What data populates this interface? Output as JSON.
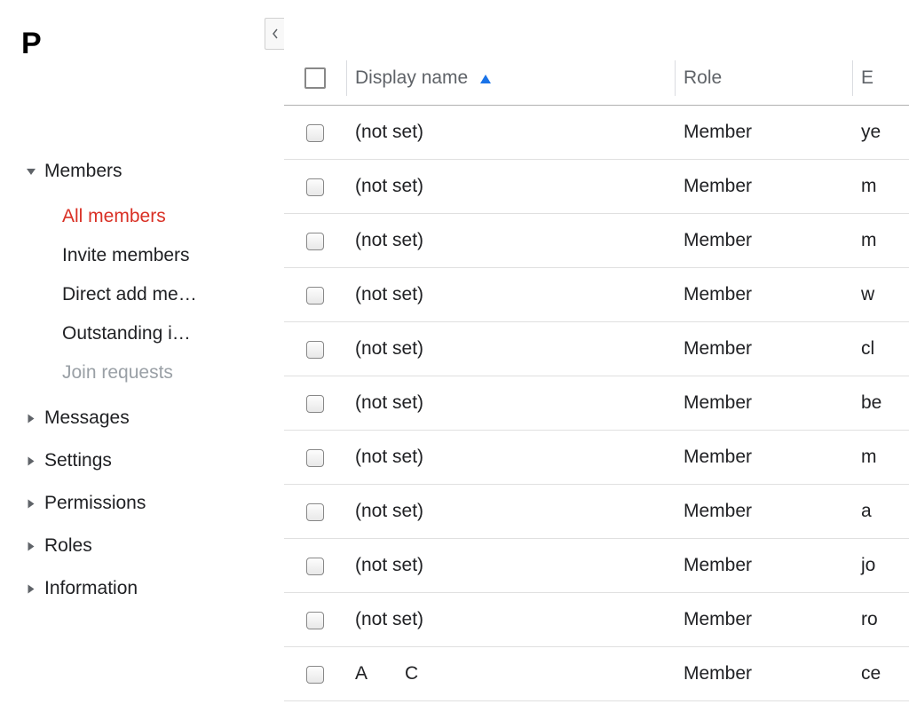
{
  "header": {
    "letter": "P"
  },
  "sidebar": {
    "sections": [
      {
        "label": "Members",
        "expanded": true,
        "items": [
          {
            "label": "All members",
            "active": true
          },
          {
            "label": "Invite members"
          },
          {
            "label": "Direct add me…"
          },
          {
            "label": "Outstanding i…"
          },
          {
            "label": "Join requests",
            "disabled": true
          }
        ]
      },
      {
        "label": "Messages",
        "expanded": false
      },
      {
        "label": "Settings",
        "expanded": false
      },
      {
        "label": "Permissions",
        "expanded": false
      },
      {
        "label": "Roles",
        "expanded": false
      },
      {
        "label": "Information",
        "expanded": false
      }
    ]
  },
  "table": {
    "columns": {
      "display_name": "Display name",
      "role": "Role",
      "extra": "E"
    },
    "sort_column": "display_name",
    "sort_direction": "asc",
    "rows": [
      {
        "display_name": "(not set)",
        "role": "Member",
        "extra": "ye"
      },
      {
        "display_name": "(not set)",
        "role": "Member",
        "extra": "m"
      },
      {
        "display_name": "(not set)",
        "role": "Member",
        "extra": "m"
      },
      {
        "display_name": "(not set)",
        "role": "Member",
        "extra": "w"
      },
      {
        "display_name": "(not set)",
        "role": "Member",
        "extra": "cl"
      },
      {
        "display_name": "(not set)",
        "role": "Member",
        "extra": "be"
      },
      {
        "display_name": "(not set)",
        "role": "Member",
        "extra": "m"
      },
      {
        "display_name": "(not set)",
        "role": "Member",
        "extra": "a"
      },
      {
        "display_name": "(not set)",
        "role": "Member",
        "extra": "jo"
      },
      {
        "display_name": "(not set)",
        "role": "Member",
        "extra": "ro"
      },
      {
        "display_name": "A  C",
        "role": "Member",
        "extra": "ce"
      }
    ]
  }
}
